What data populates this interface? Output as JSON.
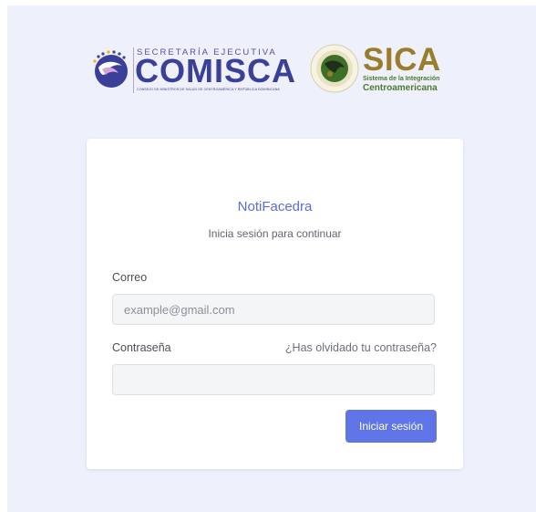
{
  "logos": {
    "comisca": {
      "subtitle": "SECRETARÍA EJECUTIVA",
      "name": "COMISCA",
      "tagline": "CONSEJO DE MINISTROS DE SALUD DE CENTROAMÉRICA Y REPÚBLICA DOMINICANA"
    },
    "sica": {
      "name": "SICA",
      "line1": "Sistema de la Integración",
      "line2": "Centroamericana"
    }
  },
  "login": {
    "app_name": "NotiFacedra",
    "subtitle": "Inicia sesión para continuar",
    "email_label": "Correo",
    "email_placeholder": "example@gmail.com",
    "email_value": "",
    "password_label": "Contraseña",
    "password_value": "",
    "forgot_password": "¿Has olvidado tu contraseña?",
    "submit_label": "Iniciar sesión"
  },
  "colors": {
    "page_background": "#eef0fc",
    "accent": "#5f74e6",
    "comisca_brand": "#3a3f99",
    "sica_brand": "#9a7d2a",
    "sica_secondary": "#4f7a2e"
  }
}
